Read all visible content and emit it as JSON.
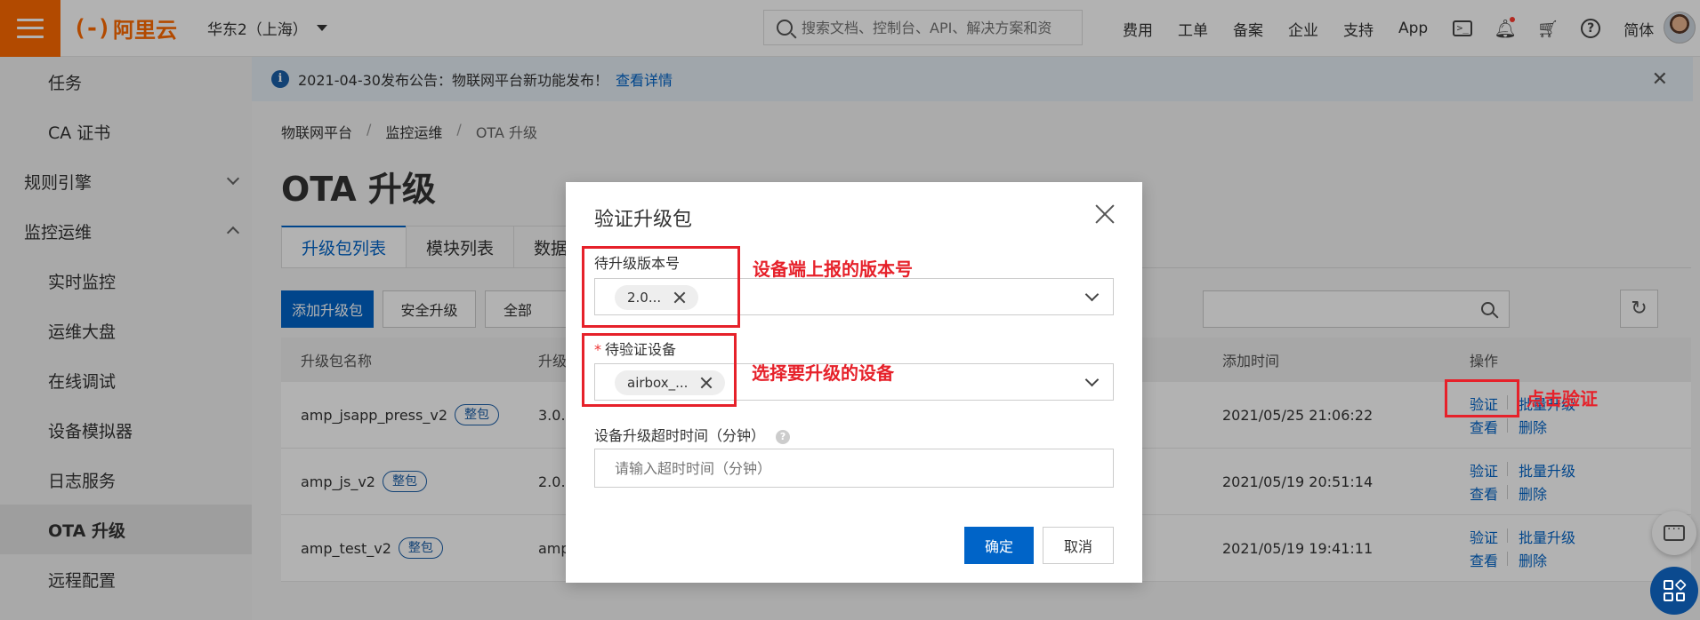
{
  "header": {
    "logo_text": "阿里云",
    "logo_mark": "(-)",
    "region": "华东2（上海）",
    "search_placeholder": "搜索文档、控制台、API、解决方案和资",
    "nav": [
      "费用",
      "工单",
      "备案",
      "企业",
      "支持",
      "App"
    ],
    "lang": "简体",
    "icons": [
      "terminal-icon",
      "bell-icon",
      "cart-icon",
      "help-icon"
    ]
  },
  "sidebar": {
    "items": [
      {
        "label": "任务",
        "level": "sub"
      },
      {
        "label": "CA 证书",
        "level": "sub"
      },
      {
        "label": "规则引擎",
        "level": "top",
        "chevron": "down"
      },
      {
        "label": "监控运维",
        "level": "top",
        "chevron": "up"
      },
      {
        "label": "实时监控",
        "level": "sub"
      },
      {
        "label": "运维大盘",
        "level": "sub"
      },
      {
        "label": "在线调试",
        "level": "sub"
      },
      {
        "label": "设备模拟器",
        "level": "sub"
      },
      {
        "label": "日志服务",
        "level": "sub"
      },
      {
        "label": "OTA 升级",
        "level": "sub",
        "active": true
      },
      {
        "label": "远程配置",
        "level": "sub"
      }
    ]
  },
  "notice": {
    "text": "2021-04-30发布公告：物联网平台新功能发布！",
    "link": "查看详情"
  },
  "breadcrumb": [
    "物联网平台",
    "监控运维",
    "OTA 升级"
  ],
  "page_title": "OTA 升级",
  "tabs": [
    "升级包列表",
    "模块列表",
    "数据"
  ],
  "toolbar": {
    "add_package": "添加升级包",
    "secure_upgrade": "安全升级",
    "all_filter": "全部"
  },
  "table": {
    "headers": {
      "name": "升级包名称",
      "version": "升级",
      "added_time": "添加时间",
      "ops": "操作"
    },
    "rows": [
      {
        "name": "amp_jsapp_press_v2",
        "tag": "整包",
        "version": "3.0.0",
        "added_time": "2021/05/25 21:06:22",
        "ops_line1": [
          "验证",
          "批量升级"
        ],
        "ops_line2": [
          "查看",
          "删除"
        ]
      },
      {
        "name": "amp_js_v2",
        "tag": "整包",
        "version": "2.0.0",
        "added_time": "2021/05/19 20:51:14",
        "ops_line1": [
          "验证",
          "批量升级"
        ],
        "ops_line2": [
          "查看",
          "删除"
        ]
      },
      {
        "name": "amp_test_v2",
        "tag": "整包",
        "version": "amp",
        "added_time": "2021/05/19 19:41:11",
        "ops_line1": [
          "验证",
          "批量升级"
        ],
        "ops_line2": [
          "查看",
          "删除"
        ]
      }
    ]
  },
  "dialog": {
    "title": "验证升级包",
    "field_version_label": "待升级版本号",
    "field_version_value": "2.0...",
    "field_device_label": "待验证设备",
    "field_device_value": "airbox_...",
    "field_timeout_label": "设备升级超时时间（分钟）",
    "field_timeout_placeholder": "请输入超时时间（分钟）",
    "ok": "确定",
    "cancel": "取消"
  },
  "annotations": {
    "version_note": "设备端上报的版本号",
    "device_note": "选择要升级的设备",
    "verify_note": "点击验证",
    "color": "#e6212a"
  },
  "colors": {
    "brand": "#ff6a00",
    "primary": "#0064c8"
  }
}
